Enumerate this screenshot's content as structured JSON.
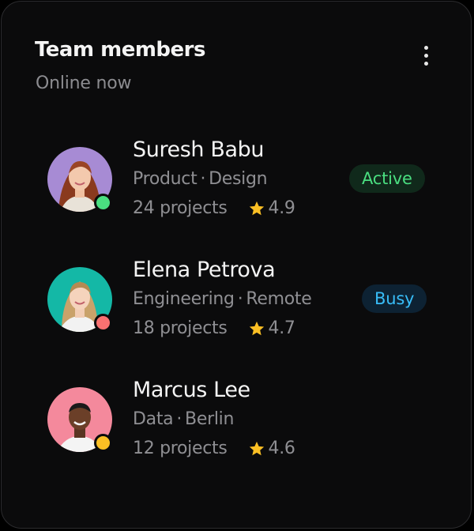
{
  "header": {
    "title": "Team members",
    "subtitle": "Online now"
  },
  "members": [
    {
      "name": "Suresh Babu",
      "dept": "Product",
      "detail": "Design",
      "projects": "24 projects",
      "rating": "4.9",
      "badge": "Active",
      "status_color": "#4ade80",
      "avatar_bg": "#a78bd4"
    },
    {
      "name": "Elena Petrova",
      "dept": "Engineering",
      "detail": "Remote",
      "projects": "18 projects",
      "rating": "4.7",
      "badge": "Busy",
      "status_color": "#f87171",
      "avatar_bg": "#14b8a6"
    },
    {
      "name": "Marcus Lee",
      "dept": "Data",
      "detail": "Berlin",
      "projects": "12 projects",
      "rating": "4.6",
      "badge": "",
      "status_color": "#fbbf24",
      "avatar_bg": "#f4899c"
    }
  ],
  "colors": {
    "active_text": "#4ade80",
    "active_bg": "#10291b",
    "busy_text": "#38bdf8",
    "busy_bg": "#0d2233",
    "star": "#fbbf24"
  }
}
